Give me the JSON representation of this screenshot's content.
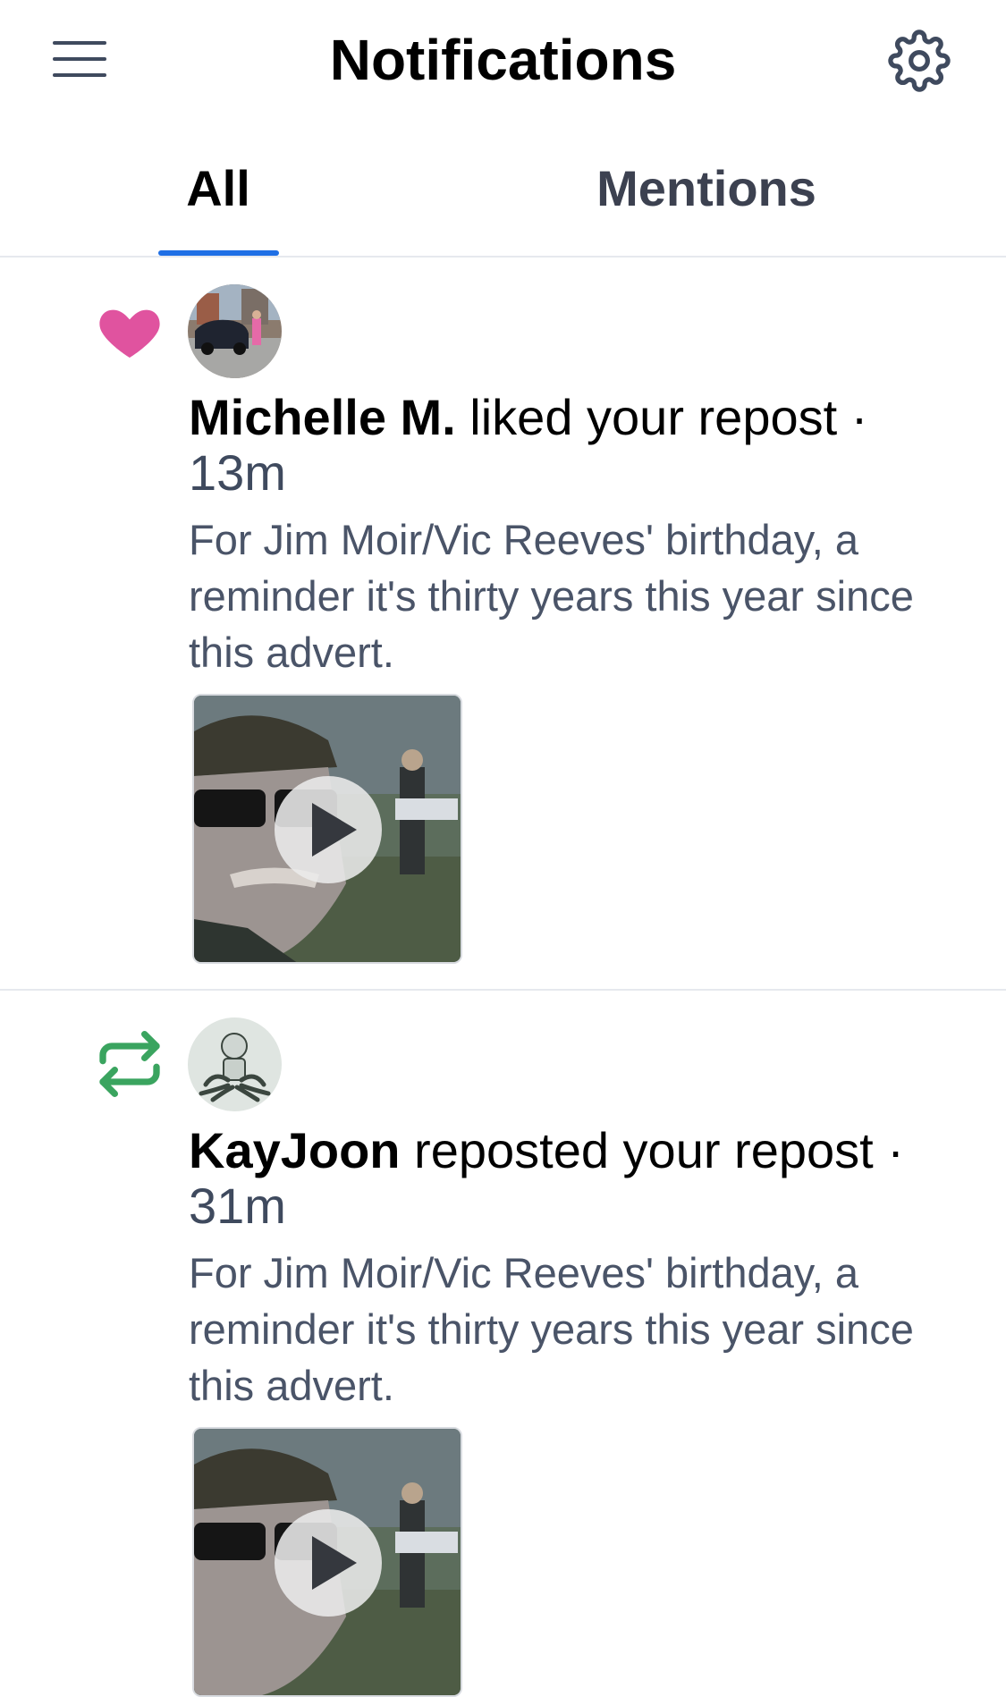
{
  "header": {
    "title": "Notifications",
    "menu_icon": "hamburger-menu-icon",
    "settings_icon": "gear-icon"
  },
  "tabs": [
    {
      "label": "All",
      "active": true
    },
    {
      "label": "Mentions",
      "active": false
    }
  ],
  "colors": {
    "accent": "#1f6fe5",
    "like": "#e0539f",
    "repost": "#3aa45f",
    "secondary_text": "#4a5468"
  },
  "notifications": [
    {
      "type_icon": "heart-icon",
      "user": "Michelle M.",
      "action": " liked your repost · ",
      "time": "13m",
      "snippet": "For Jim Moir/Vic Reeves' birthday, a reminder it's thirty years this year since this advert.",
      "media_icon": "play-icon"
    },
    {
      "type_icon": "repost-icon",
      "user": "KayJoon",
      "action": " reposted your repost · ",
      "time": "31m",
      "snippet": "For Jim Moir/Vic Reeves' birthday, a reminder it's thirty years this year since this advert.",
      "media_icon": "play-icon"
    }
  ]
}
